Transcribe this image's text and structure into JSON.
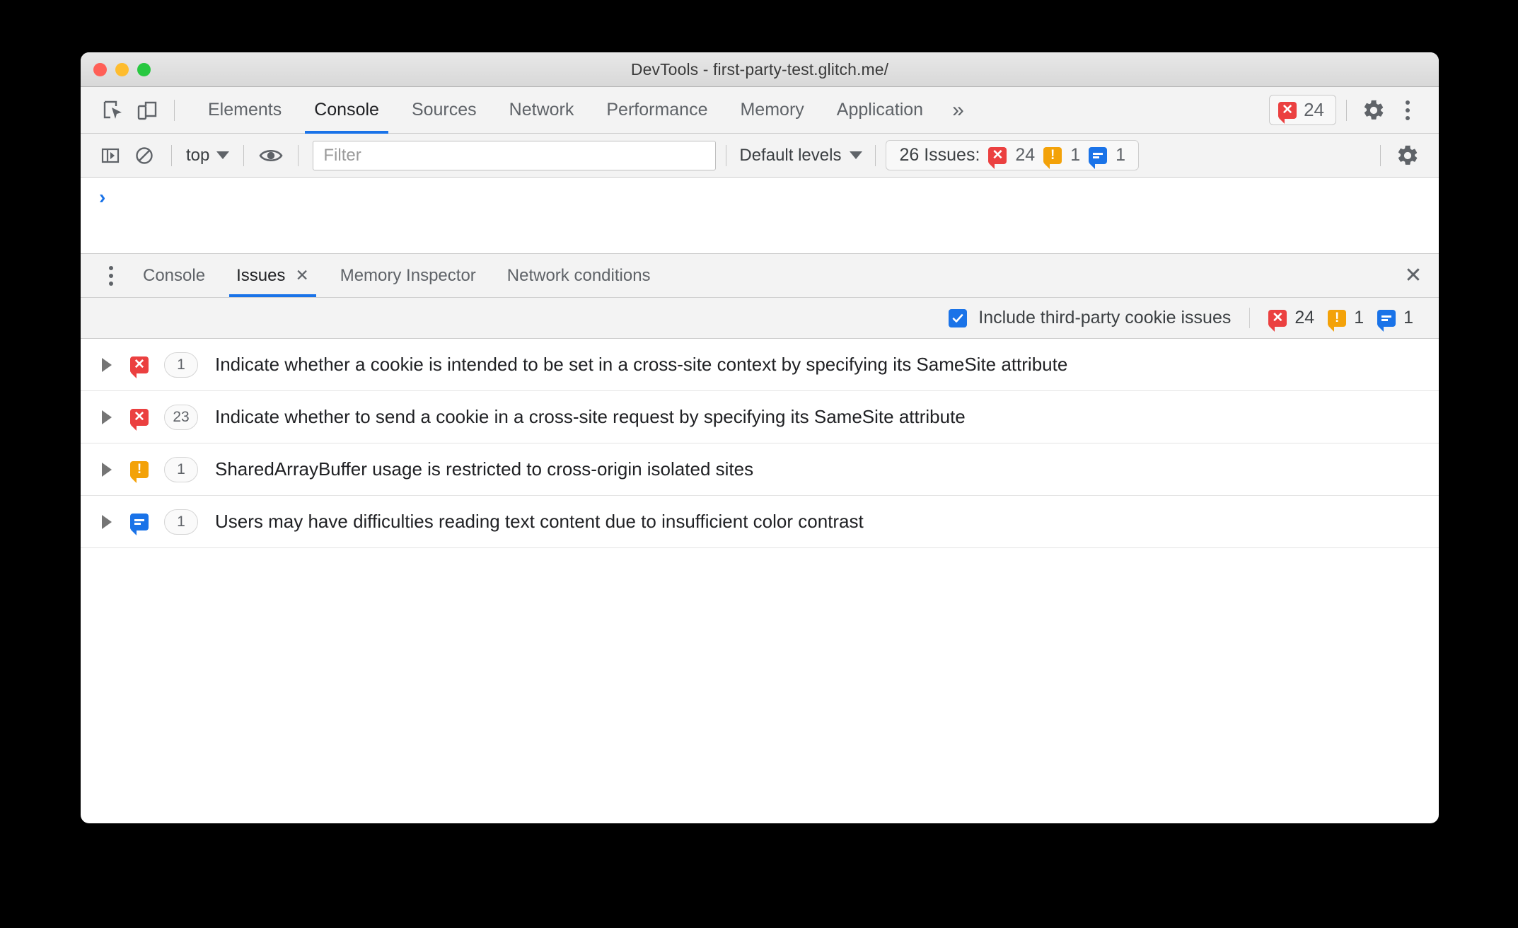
{
  "window": {
    "title": "DevTools - first-party-test.glitch.me/"
  },
  "main_tabs": {
    "inspect_icon": "inspect-cursor-icon",
    "device_icon": "device-toolbar-icon",
    "items": [
      {
        "label": "Elements",
        "active": false
      },
      {
        "label": "Console",
        "active": true
      },
      {
        "label": "Sources",
        "active": false
      },
      {
        "label": "Network",
        "active": false
      },
      {
        "label": "Performance",
        "active": false
      },
      {
        "label": "Memory",
        "active": false
      },
      {
        "label": "Application",
        "active": false
      }
    ],
    "more_label": "»",
    "error_badge": {
      "icon": "error-bubble-icon",
      "count": "24"
    },
    "settings_icon": "gear-icon",
    "menu_icon": "kebab-menu-icon"
  },
  "console_toolbar": {
    "sidebar_icon": "console-sidebar-icon",
    "clear_icon": "clear-console-icon",
    "context": "top",
    "eye_icon": "live-expression-icon",
    "filter_placeholder": "Filter",
    "levels": "Default levels",
    "issues_label": "26 Issues:",
    "issues_counts": {
      "errors": "24",
      "warnings": "1",
      "info": "1"
    },
    "settings_icon": "gear-icon"
  },
  "console_output": {
    "prompt": "›"
  },
  "drawer": {
    "menu_icon": "kebab-menu-icon",
    "tabs": [
      {
        "label": "Console",
        "active": false,
        "closable": false
      },
      {
        "label": "Issues",
        "active": true,
        "closable": true,
        "close_glyph": "✕"
      },
      {
        "label": "Memory Inspector",
        "active": false,
        "closable": false
      },
      {
        "label": "Network conditions",
        "active": false,
        "closable": false
      }
    ],
    "close_glyph": "✕"
  },
  "issues_filter": {
    "checkbox_label": "Include third-party cookie issues",
    "checkbox_checked": true,
    "counts": {
      "errors": "24",
      "warnings": "1",
      "info": "1"
    }
  },
  "issues": [
    {
      "severity": "error",
      "count": "1",
      "title": "Indicate whether a cookie is intended to be set in a cross-site context by specifying its SameSite attribute"
    },
    {
      "severity": "error",
      "count": "23",
      "title": "Indicate whether to send a cookie in a cross-site request by specifying its SameSite attribute"
    },
    {
      "severity": "warning",
      "count": "1",
      "title": "SharedArrayBuffer usage is restricted to cross-origin isolated sites"
    },
    {
      "severity": "info",
      "count": "1",
      "title": "Users may have difficulties reading text content due to insufficient color contrast"
    }
  ],
  "colors": {
    "accent": "#1a73e8",
    "error": "#eb4040",
    "warning": "#f3a209",
    "info": "#1a73e8"
  }
}
